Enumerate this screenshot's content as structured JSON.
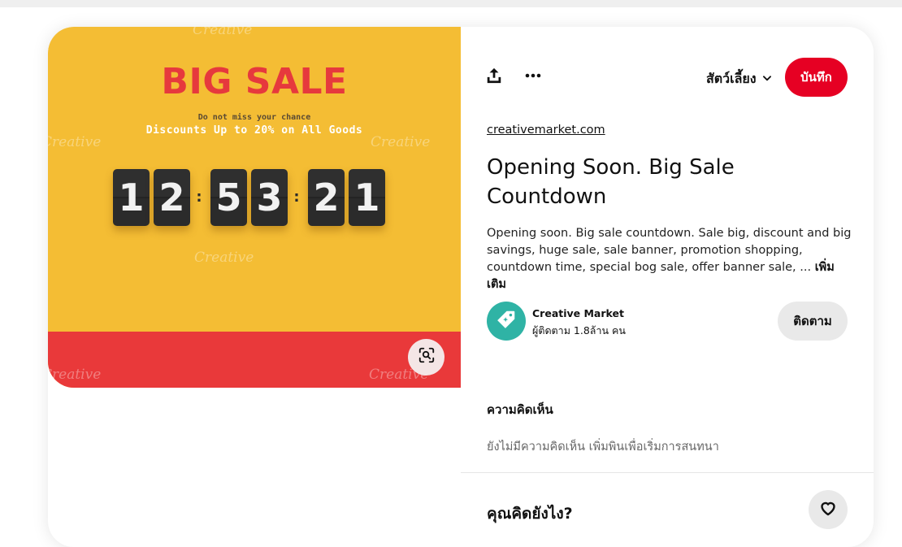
{
  "pin_image": {
    "headline": "BIG SALE",
    "tagline": "Do not miss your chance",
    "subheadline": "Discounts Up to 20% on All Goods",
    "countdown": {
      "hours": [
        "1",
        "2"
      ],
      "minutes": [
        "5",
        "3"
      ],
      "seconds": [
        "2",
        "1"
      ]
    },
    "watermark": "Creative",
    "colors": {
      "background": "#f4bd34",
      "band": "#e9393a",
      "headline": "#e6393d"
    },
    "visual_search_icon": "lens-search-icon"
  },
  "toolbar": {
    "share_icon": "share-upload-icon",
    "more_icon": "more-options-icon",
    "board_name": "สัตว์เลี้ยง",
    "board_chevron_icon": "chevron-down-icon",
    "save_label": "บันทึก",
    "save_color": "#e60023"
  },
  "pin": {
    "source_link": "creativemarket.com",
    "title": "Opening Soon. Big Sale Countdown",
    "description": "Opening soon. Big sale countdown. Sale big, discount and big savings, huge sale, sale banner, promotion shopping, countdown time, special bog sale, offer banner sale, ...",
    "more_label": "เพิ่มเติม"
  },
  "creator": {
    "name": "Creative Market",
    "followers": "ผู้ติดตาม 1.8ล้าน คน",
    "avatar_color": "#2fb3a5",
    "follow_label": "ติดตาม"
  },
  "comments": {
    "heading": "ความคิดเห็น",
    "empty_text": "ยังไม่มีความคิดเห็น เพิ่มพินเพื่อเริ่มการสนทนา"
  },
  "reaction": {
    "heading": "คุณคิดยังไง?",
    "icon": "heart-icon"
  }
}
